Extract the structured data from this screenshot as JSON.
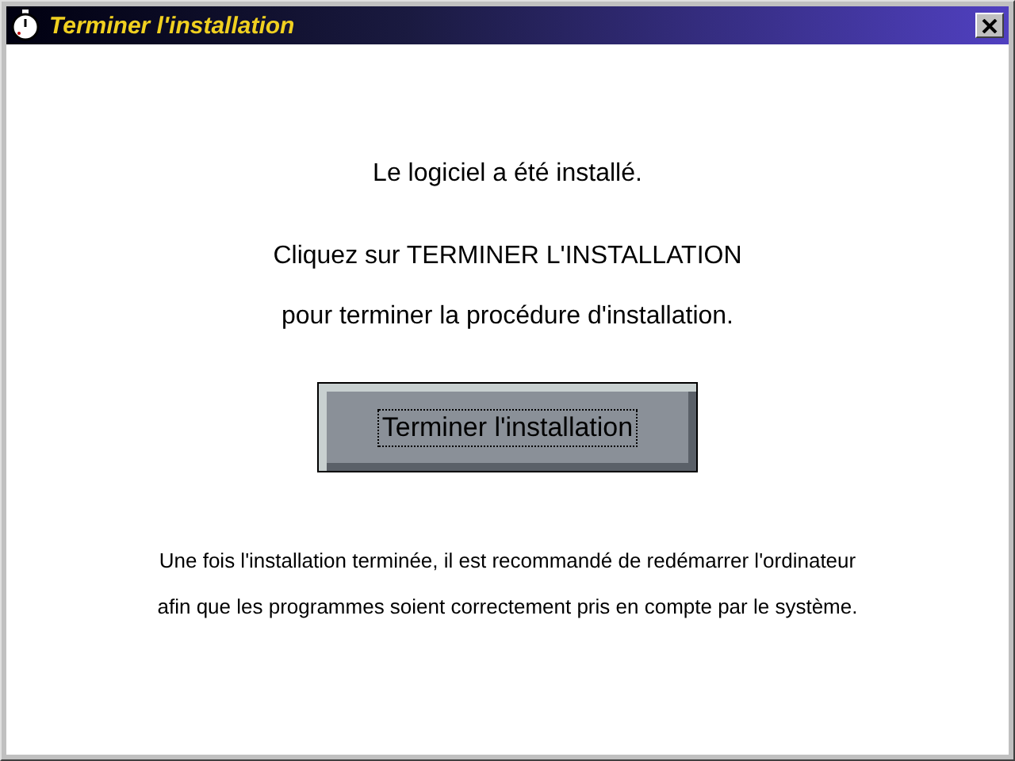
{
  "window": {
    "title": "Terminer l'installation"
  },
  "messages": [
    "Le logiciel a été installé.",
    "Cliquez sur TERMINER L'INSTALLATION",
    "pour terminer la procédure d'installation."
  ],
  "button": {
    "label": "Terminer l'installation",
    "focused": true
  },
  "notes": [
    "Une fois l'installation terminée, il est recommandé de redémarrer l'ordinateur",
    "afin que les programmes soient correctement pris en compte par le système."
  ]
}
